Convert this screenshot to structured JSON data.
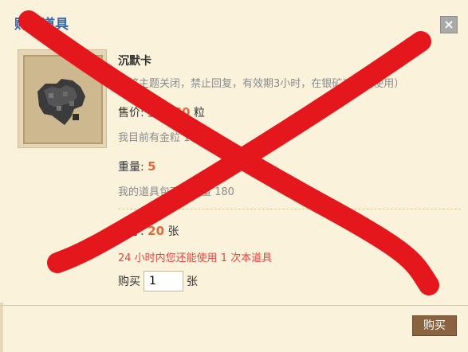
{
  "dialog": {
    "title": "购买道具",
    "close_label": "×",
    "item": {
      "name": "沉默卡",
      "description": "（将主题关闭，禁止回复，有效期3小时，在银矿工茶馆使用）",
      "price_prefix": "售价: 金粒",
      "price_value": "60",
      "price_unit": "粒",
      "gold_line": "我目前有金粒 15 粒",
      "weight_prefix": "重量:",
      "weight_value": "5",
      "capacity_line": "我的道具包可用容量 180"
    },
    "stock_prefix": "库存:",
    "stock_value": "20",
    "stock_unit": "张",
    "limit_line": "24 小时内您还能使用 1 次本道具",
    "quantity": {
      "label": "购买",
      "value": "1",
      "unit": "张"
    },
    "buy_button": "购买"
  },
  "overlay": {
    "description": "red X mark crossing the dialog",
    "color": "#e3171c"
  }
}
